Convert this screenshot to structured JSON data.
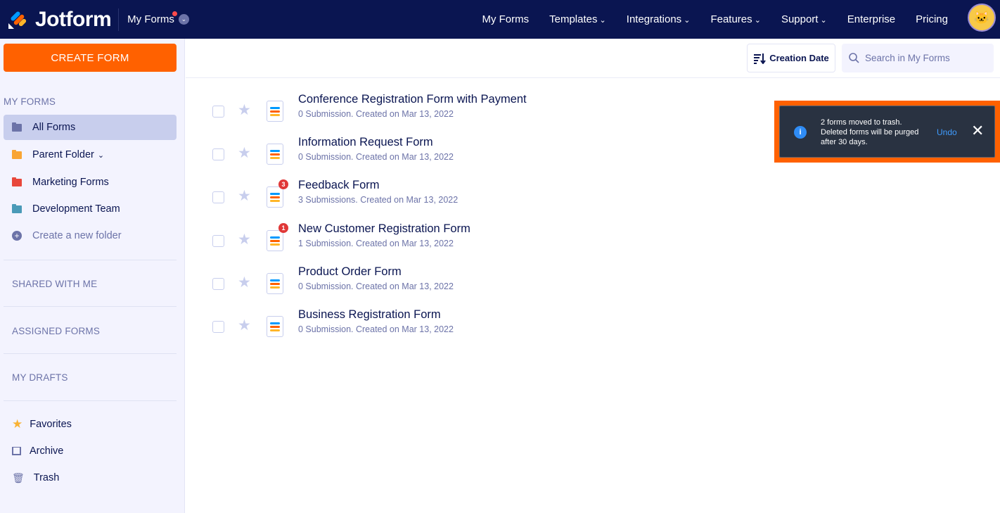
{
  "header": {
    "brand": "Jotform",
    "context_menu": "My Forms",
    "nav": [
      "My Forms",
      "Templates",
      "Integrations",
      "Features",
      "Support",
      "Enterprise",
      "Pricing"
    ],
    "nav_dropdowns": [
      false,
      true,
      true,
      true,
      true,
      false,
      false
    ]
  },
  "sidebar": {
    "create_label": "CREATE FORM",
    "my_forms_heading": "MY FORMS",
    "folders": [
      {
        "label": "All Forms",
        "color": "#6c73a8"
      },
      {
        "label": "Parent Folder",
        "color": "#f9a534"
      },
      {
        "label": "Marketing Forms",
        "color": "#e8473b"
      },
      {
        "label": "Development Team",
        "color": "#4a9ab8"
      }
    ],
    "new_folder": "Create a new folder",
    "shared": "SHARED WITH ME",
    "assigned": "ASSIGNED FORMS",
    "drafts": "MY DRAFTS",
    "favorites": "Favorites",
    "archive": "Archive",
    "trash": "Trash"
  },
  "toolbar": {
    "sort_label": "Creation Date",
    "search_placeholder": "Search in My Forms"
  },
  "forms": [
    {
      "title": "Conference Registration Form with Payment",
      "meta": "0 Submission. Created on Mar 13, 2022",
      "badge": ""
    },
    {
      "title": "Information Request Form",
      "meta": "0 Submission. Created on Mar 13, 2022",
      "badge": ""
    },
    {
      "title": "Feedback Form",
      "meta": "3 Submissions. Created on Mar 13, 2022",
      "badge": "3"
    },
    {
      "title": "New Customer Registration Form",
      "meta": "1 Submission. Created on Mar 13, 2022",
      "badge": "1"
    },
    {
      "title": "Product Order Form",
      "meta": "0 Submission. Created on Mar 13, 2022",
      "badge": ""
    },
    {
      "title": "Business Registration Form",
      "meta": "0 Submission. Created on Mar 13, 2022",
      "badge": ""
    }
  ],
  "toast": {
    "line1": "2 forms moved to trash.",
    "line2": "Deleted forms will be purged after 30 days.",
    "undo": "Undo"
  }
}
